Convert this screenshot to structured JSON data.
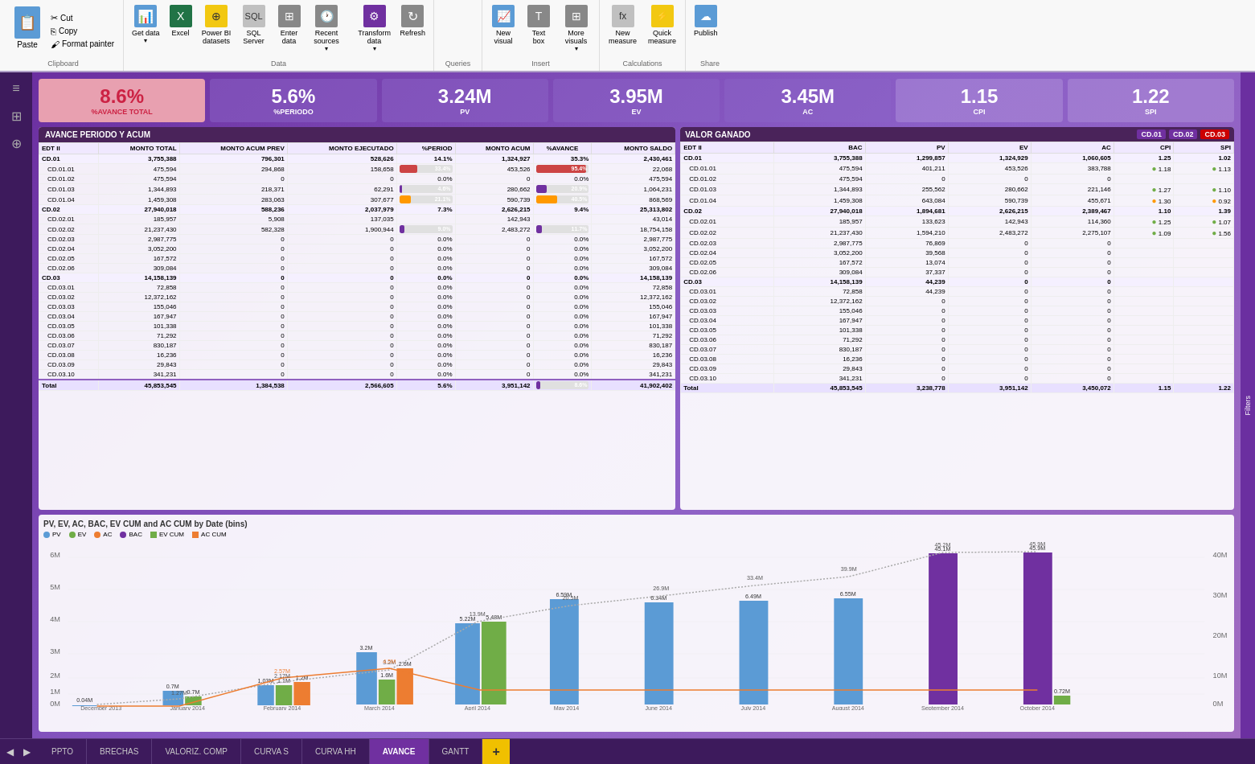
{
  "ribbon": {
    "clipboard": {
      "label": "Clipboard",
      "paste": "Paste",
      "cut": "Cut",
      "copy": "Copy",
      "format_painter": "Format painter"
    },
    "data": {
      "label": "Data",
      "get_data": "Get data",
      "excel": "Excel",
      "power_bi": "Power BI datasets",
      "sql_server": "SQL Server",
      "enter_data": "Enter data",
      "recent_sources": "Recent sources",
      "transform_data": "Transform data",
      "refresh": "Refresh"
    },
    "queries": {
      "label": "Queries"
    },
    "insert": {
      "label": "Insert",
      "new_visual": "New visual",
      "text_box": "Text box",
      "more_visuals": "More visuals"
    },
    "calculations": {
      "label": "Calculations",
      "new_measure": "New measure",
      "quick_measure": "Quick measure"
    },
    "share": {
      "label": "Share",
      "publish": "Publish"
    }
  },
  "kpis": [
    {
      "value": "8.6%",
      "label": "%AVANCE TOTAL",
      "type": "highlight"
    },
    {
      "value": "5.6%",
      "label": "%PERIODO",
      "type": "blue"
    },
    {
      "value": "3.24M",
      "label": "PV",
      "type": "purple"
    },
    {
      "value": "3.95M",
      "label": "EV",
      "type": "purple"
    },
    {
      "value": "3.45M",
      "label": "AC",
      "type": "purple"
    },
    {
      "value": "1.15",
      "label": "CPI",
      "type": "light"
    },
    {
      "value": "1.22",
      "label": "SPI",
      "type": "light"
    }
  ],
  "left_table": {
    "title": "AVANCE PERIODO Y ACUM",
    "columns": [
      "EDT II",
      "MONTO TOTAL",
      "MONTO ACUM PREV",
      "MONTO EJECUTADO",
      "%PERIOD",
      "MONTO ACUM",
      "%AVANCE",
      "MONTO SALDO"
    ],
    "rows": [
      {
        "id": "CD.01",
        "total": "3,755,388",
        "acum_prev": "796,301",
        "ejecutado": "528,626",
        "period": "14.1%",
        "acum": "1,324,927",
        "avance": "35.3%",
        "saldo": "2,430,461",
        "parent": true
      },
      {
        "id": "CD.01.01",
        "total": "475,594",
        "acum_prev": "294,868",
        "ejecutado": "158,658",
        "period": "33.4%",
        "acum": "453,526",
        "avance": "95.4%",
        "saldo": "22,068",
        "bar_color": "red"
      },
      {
        "id": "CD.01.02",
        "total": "475,594",
        "acum_prev": "0",
        "ejecutado": "0",
        "period": "0.0%",
        "acum": "0",
        "avance": "0.0%",
        "saldo": "475,594"
      },
      {
        "id": "CD.01.03",
        "total": "1,344,893",
        "acum_prev": "218,371",
        "ejecutado": "62,291",
        "period": "4.6%",
        "acum": "280,662",
        "avance": "20.9%",
        "saldo": "1,064,231"
      },
      {
        "id": "CD.01.04",
        "total": "1,459,308",
        "acum_prev": "283,063",
        "ejecutado": "307,677",
        "period": "21.1%",
        "acum": "590,739",
        "avance": "40.5%",
        "saldo": "868,569",
        "bar_color": "orange"
      },
      {
        "id": "CD.02",
        "total": "27,940,018",
        "acum_prev": "588,236",
        "ejecutado": "2,037,979",
        "period": "7.3%",
        "acum": "2,626,215",
        "avance": "9.4%",
        "saldo": "25,313,802",
        "parent": true
      },
      {
        "id": "CD.02.01",
        "total": "185,957",
        "acum_prev": "5,908",
        "ejecutado": "137,035",
        "period": "",
        "acum": "142,943",
        "avance": "",
        "saldo": "43,014"
      },
      {
        "id": "CD.02.02",
        "total": "21,237,430",
        "acum_prev": "582,328",
        "ejecutado": "1,900,944",
        "period": "9.0%",
        "acum": "2,483,272",
        "avance": "11.7%",
        "saldo": "18,754,158"
      },
      {
        "id": "CD.02.03",
        "total": "2,987,775",
        "acum_prev": "0",
        "ejecutado": "0",
        "period": "0.0%",
        "acum": "0",
        "avance": "0.0%",
        "saldo": "2,987,775"
      },
      {
        "id": "CD.02.04",
        "total": "3,052,200",
        "acum_prev": "0",
        "ejecutado": "0",
        "period": "0.0%",
        "acum": "0",
        "avance": "0.0%",
        "saldo": "3,052,200"
      },
      {
        "id": "CD.02.05",
        "total": "167,572",
        "acum_prev": "0",
        "ejecutado": "0",
        "period": "0.0%",
        "acum": "0",
        "avance": "0.0%",
        "saldo": "167,572"
      },
      {
        "id": "CD.02.06",
        "total": "309,084",
        "acum_prev": "0",
        "ejecutado": "0",
        "period": "0.0%",
        "acum": "0",
        "avance": "0.0%",
        "saldo": "309,084"
      },
      {
        "id": "CD.03",
        "total": "14,158,139",
        "acum_prev": "0",
        "ejecutado": "0",
        "period": "0.0%",
        "acum": "0",
        "avance": "0.0%",
        "saldo": "14,158,139",
        "parent": true
      },
      {
        "id": "CD.03.01",
        "total": "72,858",
        "acum_prev": "0",
        "ejecutado": "0",
        "period": "0.0%",
        "acum": "0",
        "avance": "0.0%",
        "saldo": "72,858"
      },
      {
        "id": "CD.03.02",
        "total": "12,372,162",
        "acum_prev": "0",
        "ejecutado": "0",
        "period": "0.0%",
        "acum": "0",
        "avance": "0.0%",
        "saldo": "12,372,162"
      },
      {
        "id": "CD.03.03",
        "total": "155,046",
        "acum_prev": "0",
        "ejecutado": "0",
        "period": "0.0%",
        "acum": "0",
        "avance": "0.0%",
        "saldo": "155,046"
      },
      {
        "id": "CD.03.04",
        "total": "167,947",
        "acum_prev": "0",
        "ejecutado": "0",
        "period": "0.0%",
        "acum": "0",
        "avance": "0.0%",
        "saldo": "167,947"
      },
      {
        "id": "CD.03.05",
        "total": "101,338",
        "acum_prev": "0",
        "ejecutado": "0",
        "period": "0.0%",
        "acum": "0",
        "avance": "0.0%",
        "saldo": "101,338"
      },
      {
        "id": "CD.03.06",
        "total": "71,292",
        "acum_prev": "0",
        "ejecutado": "0",
        "period": "0.0%",
        "acum": "0",
        "avance": "0.0%",
        "saldo": "71,292"
      },
      {
        "id": "CD.03.07",
        "total": "830,187",
        "acum_prev": "0",
        "ejecutado": "0",
        "period": "0.0%",
        "acum": "0",
        "avance": "0.0%",
        "saldo": "830,187"
      },
      {
        "id": "CD.03.08",
        "total": "16,236",
        "acum_prev": "0",
        "ejecutado": "0",
        "period": "0.0%",
        "acum": "0",
        "avance": "0.0%",
        "saldo": "16,236"
      },
      {
        "id": "CD.03.09",
        "total": "29,843",
        "acum_prev": "0",
        "ejecutado": "0",
        "period": "0.0%",
        "acum": "0",
        "avance": "0.0%",
        "saldo": "29,843"
      },
      {
        "id": "CD.03.10",
        "total": "341,231",
        "acum_prev": "0",
        "ejecutado": "0",
        "period": "0.0%",
        "acum": "0",
        "avance": "0.0%",
        "saldo": "341,231"
      },
      {
        "id": "Total",
        "total": "45,853,545",
        "acum_prev": "1,384,538",
        "ejecutado": "2,566,605",
        "period": "5.6%",
        "acum": "3,951,142",
        "avance": "8.6%",
        "saldo": "41,902,402",
        "total_row": true
      }
    ]
  },
  "right_table": {
    "title": "VALOR GANADO",
    "badges": [
      "CD.01",
      "CD.02",
      "CD.03"
    ],
    "columns": [
      "EDT II",
      "BAC",
      "PV",
      "EV",
      "AC",
      "CPI",
      "SPI"
    ],
    "rows": [
      {
        "id": "CD.01",
        "bac": "3,755,388",
        "pv": "1,299,857",
        "ev": "1,324,929",
        "ac": "1,060,605",
        "cpi": "1.25",
        "spi": "1.02",
        "parent": true
      },
      {
        "id": "CD.01.01",
        "bac": "475,594",
        "pv": "401,211",
        "ev": "453,526",
        "ac": "383,788",
        "cpi": "1.18",
        "spi": "1.13",
        "dot": "green"
      },
      {
        "id": "CD.01.02",
        "bac": "475,594",
        "pv": "0",
        "ev": "0",
        "ac": "0",
        "cpi": "",
        "spi": ""
      },
      {
        "id": "CD.01.03",
        "bac": "1,344,893",
        "pv": "255,562",
        "ev": "280,662",
        "ac": "221,146",
        "cpi": "1.27",
        "spi": "1.10",
        "dot": "green"
      },
      {
        "id": "CD.01.04",
        "bac": "1,459,308",
        "pv": "643,084",
        "ev": "590,739",
        "ac": "455,671",
        "cpi": "1.30",
        "spi": "0.92",
        "dot": "orange"
      },
      {
        "id": "CD.02",
        "bac": "27,940,018",
        "pv": "1,894,681",
        "ev": "2,626,215",
        "ac": "2,389,467",
        "cpi": "1.10",
        "spi": "1.39",
        "parent": true
      },
      {
        "id": "CD.02.01",
        "bac": "185,957",
        "pv": "133,623",
        "ev": "142,943",
        "ac": "114,360",
        "cpi": "1.25",
        "spi": "1.07",
        "dot": "green"
      },
      {
        "id": "CD.02.02",
        "bac": "21,237,430",
        "pv": "1,594,210",
        "ev": "2,483,272",
        "ac": "2,275,107",
        "cpi": "1.09",
        "spi": "1.56",
        "dot": "green"
      },
      {
        "id": "CD.02.03",
        "bac": "2,987,775",
        "pv": "76,869",
        "ev": "0",
        "ac": "0",
        "cpi": "",
        "spi": ""
      },
      {
        "id": "CD.02.04",
        "bac": "3,052,200",
        "pv": "39,568",
        "ev": "0",
        "ac": "0",
        "cpi": "",
        "spi": ""
      },
      {
        "id": "CD.02.05",
        "bac": "167,572",
        "pv": "13,074",
        "ev": "0",
        "ac": "0",
        "cpi": "",
        "spi": ""
      },
      {
        "id": "CD.02.06",
        "bac": "309,084",
        "pv": "37,337",
        "ev": "0",
        "ac": "0",
        "cpi": "",
        "spi": ""
      },
      {
        "id": "CD.03",
        "bac": "14,158,139",
        "pv": "44,239",
        "ev": "0",
        "ac": "0",
        "cpi": "",
        "spi": "",
        "parent": true
      },
      {
        "id": "CD.03.01",
        "bac": "72,858",
        "pv": "44,239",
        "ev": "0",
        "ac": "0",
        "cpi": "",
        "spi": ""
      },
      {
        "id": "CD.03.02",
        "bac": "12,372,162",
        "pv": "0",
        "ev": "0",
        "ac": "0",
        "cpi": "",
        "spi": ""
      },
      {
        "id": "CD.03.03",
        "bac": "155,046",
        "pv": "0",
        "ev": "0",
        "ac": "0",
        "cpi": "",
        "spi": ""
      },
      {
        "id": "CD.03.04",
        "bac": "167,947",
        "pv": "0",
        "ev": "0",
        "ac": "0",
        "cpi": "",
        "spi": ""
      },
      {
        "id": "CD.03.05",
        "bac": "101,338",
        "pv": "0",
        "ev": "0",
        "ac": "0",
        "cpi": "",
        "spi": ""
      },
      {
        "id": "CD.03.06",
        "bac": "71,292",
        "pv": "0",
        "ev": "0",
        "ac": "0",
        "cpi": "",
        "spi": ""
      },
      {
        "id": "CD.03.07",
        "bac": "830,187",
        "pv": "0",
        "ev": "0",
        "ac": "0",
        "cpi": "",
        "spi": ""
      },
      {
        "id": "CD.03.08",
        "bac": "16,236",
        "pv": "0",
        "ev": "0",
        "ac": "0",
        "cpi": "",
        "spi": ""
      },
      {
        "id": "CD.03.09",
        "bac": "29,843",
        "pv": "0",
        "ev": "0",
        "ac": "0",
        "cpi": "",
        "spi": ""
      },
      {
        "id": "CD.03.10",
        "bac": "341,231",
        "pv": "0",
        "ev": "0",
        "ac": "0",
        "cpi": "",
        "spi": ""
      },
      {
        "id": "Total",
        "bac": "45,853,545",
        "pv": "3,238,778",
        "ev": "3,951,142",
        "ac": "3,450,072",
        "cpi": "1.15",
        "spi": "1.22",
        "total_row": true
      }
    ]
  },
  "chart": {
    "title": "PV, EV, AC, BAC, EV CUM and AC CUM by Date (bins)",
    "legend": [
      {
        "label": "PV",
        "color": "#5b9bd5"
      },
      {
        "label": "EV",
        "color": "#70ad47"
      },
      {
        "label": "AC",
        "color": "#ed7d31"
      },
      {
        "label": "BAC",
        "color": "#7030a0"
      },
      {
        "label": "EV CUM",
        "color": "#70ad47"
      },
      {
        "label": "AC CUM",
        "color": "#ed7d31"
      }
    ],
    "bars": [
      {
        "month": "December 2013",
        "pv": 0.04,
        "ev": 0,
        "ac": 0,
        "ev_cum": 0.04,
        "ac_cum": 0
      },
      {
        "month": "January 2014",
        "pv": 0.7,
        "ev": 0,
        "ac": 0,
        "ev_cum": 1.27,
        "ac_cum": 0
      },
      {
        "month": "February 2014",
        "pv": 1.1,
        "ev": 1.1,
        "ac": 1.2,
        "ev_cum": 2.17,
        "ac_cum": 2.57
      },
      {
        "month": "March 2014",
        "pv": 3.2,
        "ev": 1.6,
        "ac": 2.6,
        "ev_cum": 3.2,
        "ac_cum": 4.5
      },
      {
        "month": "April 2014",
        "pv": 5.22,
        "ev": 5.48,
        "ac": 0,
        "ev_cum": 13.9,
        "ac_cum": 0
      },
      {
        "month": "May 2014",
        "pv": 6.59,
        "ev": 0,
        "ac": 0,
        "ev_cum": 20.5,
        "ac_cum": 0
      },
      {
        "month": "June 2014",
        "pv": 6.34,
        "ev": 0,
        "ac": 0,
        "ev_cum": 26.9,
        "ac_cum": 0
      },
      {
        "month": "July 2014",
        "pv": 6.49,
        "ev": 0,
        "ac": 0,
        "ev_cum": 33.4,
        "ac_cum": 0
      },
      {
        "month": "August 2014",
        "pv": 6.55,
        "ev": 0,
        "ac": 0,
        "ev_cum": 39.9,
        "ac_cum": 0
      },
      {
        "month": "September 2014",
        "pv": 45.1,
        "ev": 0,
        "ac": 0,
        "ev_cum": 45.2,
        "ac_cum": 0
      },
      {
        "month": "October 2014",
        "pv": 45.9,
        "ev": 0.72,
        "ac": 0,
        "ev_cum": 45.9,
        "ac_cum": 0
      }
    ]
  },
  "tabs": [
    {
      "label": "PPTO",
      "active": false
    },
    {
      "label": "BRECHAS",
      "active": false
    },
    {
      "label": "VALORIZ. COMP",
      "active": false
    },
    {
      "label": "CURVA S",
      "active": false
    },
    {
      "label": "CURVA HH",
      "active": false
    },
    {
      "label": "AVANCE",
      "active": true
    },
    {
      "label": "GANTT",
      "active": false
    }
  ],
  "filters_label": "Filters"
}
